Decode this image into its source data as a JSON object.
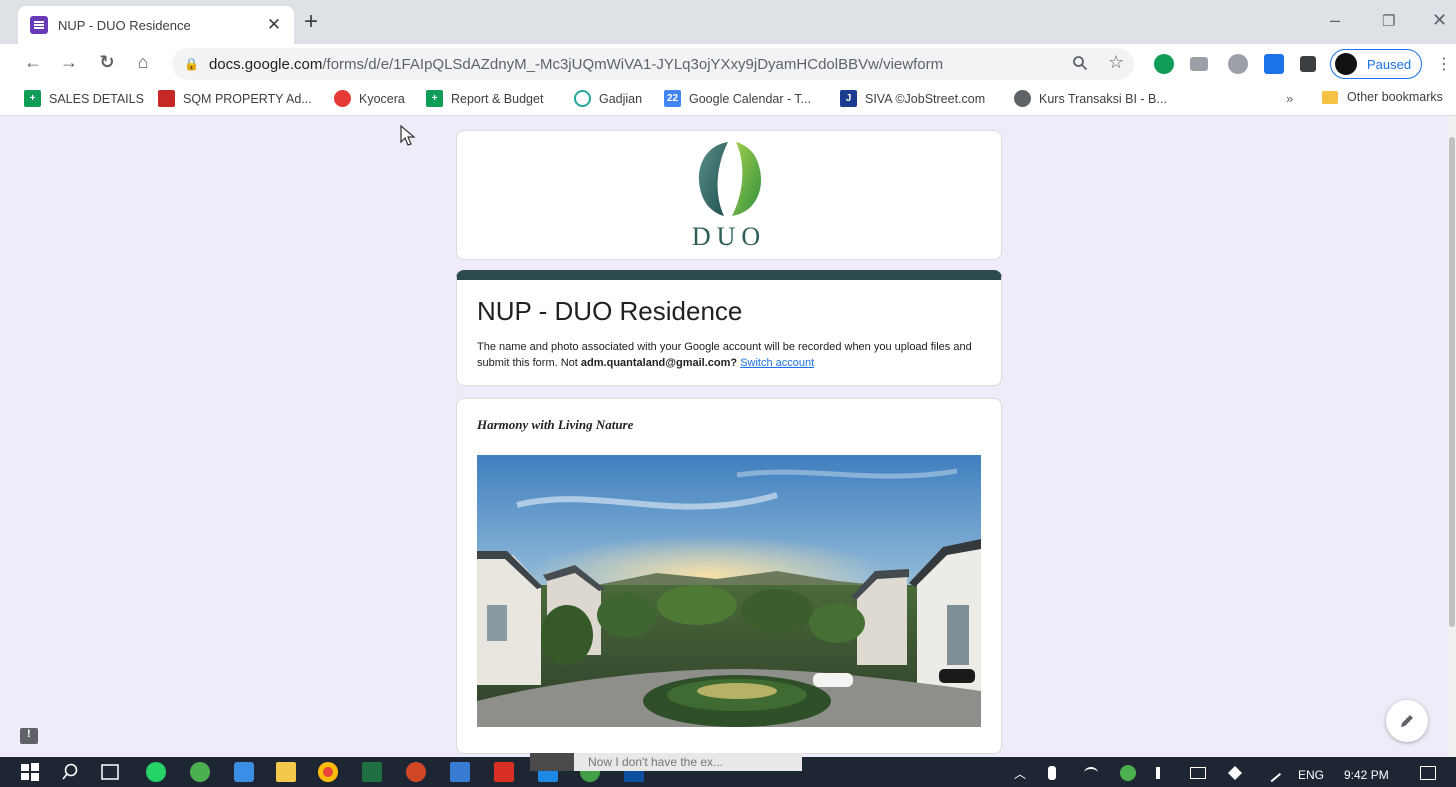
{
  "browser": {
    "tab_title": "NUP - DUO Residence",
    "tab_close": "✕",
    "new_tab": "+",
    "url_host": "docs.google.com",
    "url_path": "/forms/d/e/1FAIpQLSdAZdnyM_-Mc3jUQmWiVA1-JYLq3ojYXxy9jDyamHCdolBBVw/viewform",
    "profile_status": "Paused",
    "window_minimize": "–",
    "window_restore": "❐",
    "window_close": "✕"
  },
  "bookmarks": [
    {
      "label": "SALES DETAILS",
      "icon": "sheets-icon",
      "color": "#0f9d58"
    },
    {
      "label": "SQM PROPERTY Ad...",
      "icon": "sqm-icon",
      "color": "#c62828"
    },
    {
      "label": "Kyocera",
      "icon": "kyocera-icon",
      "color": "#e53935"
    },
    {
      "label": "Report & Budget",
      "icon": "sheets-icon",
      "color": "#0f9d58"
    },
    {
      "label": "Gadjian",
      "icon": "gadjian-icon",
      "color": "#26a69a"
    },
    {
      "label": "Google Calendar - T...",
      "icon": "calendar-icon",
      "color": "#4285f4"
    },
    {
      "label": "SIVA ©JobStreet.com",
      "icon": "jobstreet-icon",
      "color": "#1a3d8f"
    },
    {
      "label": "Kurs Transaksi BI - B...",
      "icon": "globe-icon",
      "color": "#5f6368"
    }
  ],
  "bookmarks_more": "»",
  "other_bookmarks": "Other bookmarks",
  "form": {
    "logo_text": "DUO",
    "title": "NUP - DUO Residence",
    "desc_prefix": "The name and photo associated with your Google account will be recorded when you upload files and submit this form. Not ",
    "account_email": "adm.quantaland@gmail.com?",
    "switch_account": "Switch account",
    "image_title": "Harmony with Living Nature",
    "accent_color": "#2d4a4c"
  },
  "taskbar": {
    "notification_text": "Now I don't have the ex...",
    "language": "ENG",
    "time": "9:42 PM"
  }
}
